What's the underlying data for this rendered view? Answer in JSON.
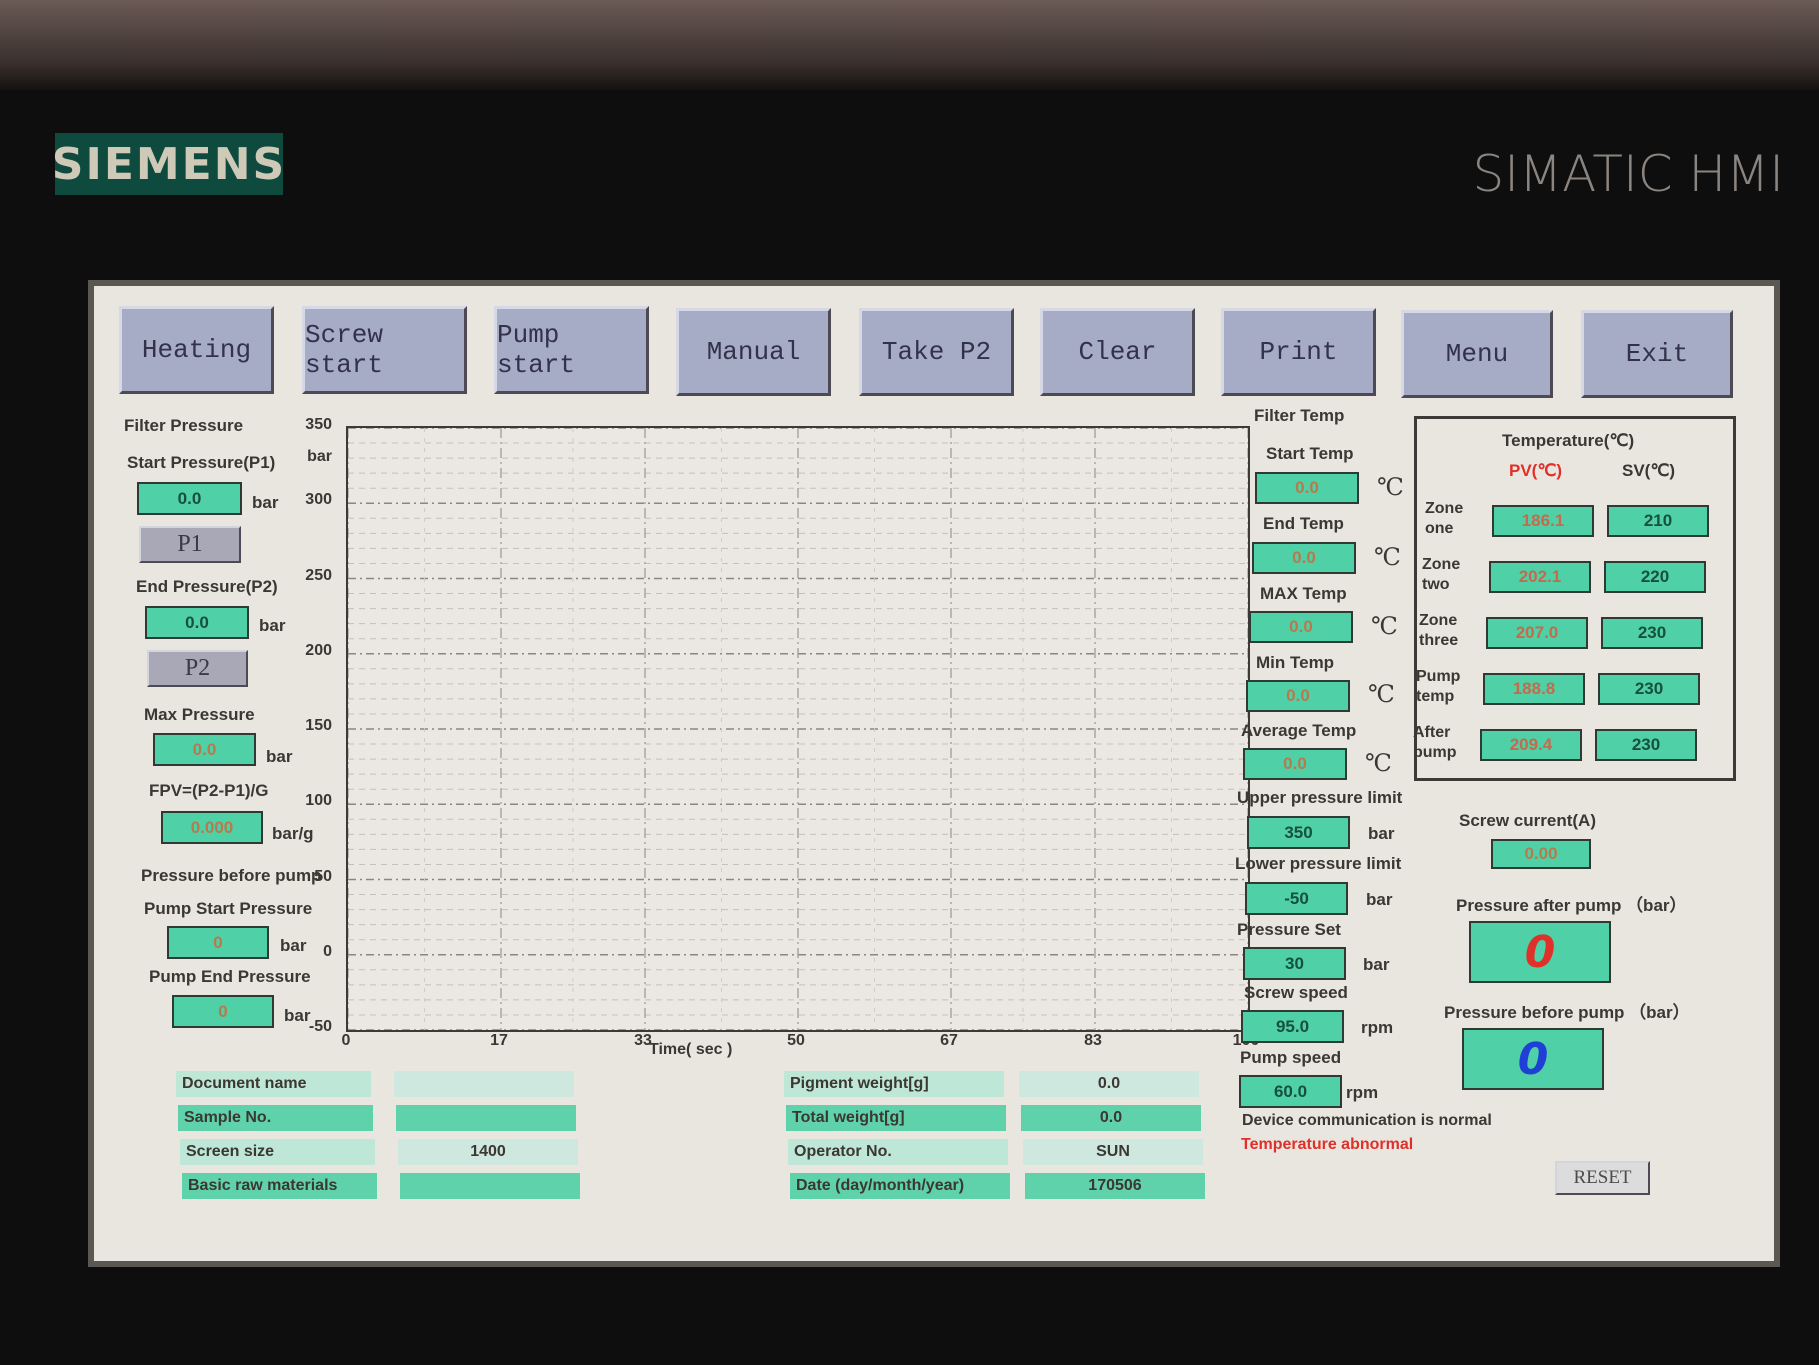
{
  "device": {
    "brand": "SIEMENS",
    "model": "SIMATIC HMI"
  },
  "toolbar": {
    "buttons": [
      "Heating",
      "Screw start",
      "Pump start",
      "Manual",
      "Take P2",
      "Clear",
      "Print",
      "Menu",
      "Exit"
    ]
  },
  "filter_pressure": {
    "title": "Filter Pressure",
    "start_label": "Start Pressure(P1)",
    "start_value": "0.0",
    "p1_button": "P1",
    "end_label": "End Pressure(P2)",
    "end_value": "0.0",
    "p2_button": "P2",
    "max_label": "Max Pressure",
    "max_value": "0.0",
    "fpv_label": "FPV=(P2-P1)/G",
    "fpv_value": "0.000",
    "unit_bar": "bar",
    "unit_barg": "bar/g"
  },
  "pump_pressure": {
    "title": "Pressure before pump",
    "start_label": "Pump Start Pressure",
    "start_value": "0",
    "end_label": "Pump End Pressure",
    "end_value": "0",
    "unit": "bar"
  },
  "chart_data": {
    "type": "line",
    "title": "",
    "xlabel": "Time( sec )",
    "ylabel": "bar",
    "x_ticks": [
      "0",
      "17",
      "33",
      "50",
      "67",
      "83",
      "100"
    ],
    "y_ticks": [
      "350",
      "300",
      "250",
      "200",
      "150",
      "100",
      "50",
      "0",
      "-50"
    ],
    "xlim": [
      0,
      100
    ],
    "ylim": [
      -50,
      350
    ],
    "grid": true,
    "series": []
  },
  "filter_temp": {
    "title": "Filter Temp",
    "unit": "℃",
    "items": [
      {
        "label": "Start Temp",
        "value": "0.0"
      },
      {
        "label": "End Temp",
        "value": "0.0"
      },
      {
        "label": "MAX Temp",
        "value": "0.0"
      },
      {
        "label": "Min Temp",
        "value": "0.0"
      },
      {
        "label": "Average Temp",
        "value": "0.0"
      }
    ]
  },
  "limits": {
    "upper_label": "Upper pressure limit",
    "upper_value": "350",
    "lower_label": "Lower pressure limit",
    "lower_value": "-50",
    "set_label": "Pressure Set",
    "set_value": "30",
    "screw_label": "Screw speed",
    "screw_value": "95.0",
    "pump_label": "Pump speed",
    "pump_value": "60.0",
    "unit_bar": "bar",
    "unit_rpm": "rpm"
  },
  "temperature": {
    "title": "Temperature(℃)",
    "pv_header": "PV(℃)",
    "sv_header": "SV(℃)",
    "zones": [
      {
        "label1": "Zone",
        "label2": "one",
        "pv": "186.1",
        "sv": "210"
      },
      {
        "label1": "Zone",
        "label2": "two",
        "pv": "202.1",
        "sv": "220"
      },
      {
        "label1": "Zone",
        "label2": "three",
        "pv": "207.0",
        "sv": "230"
      },
      {
        "label1": "Pump",
        "label2": "temp",
        "pv": "188.8",
        "sv": "230"
      },
      {
        "label1": "After",
        "label2": "pump",
        "pv": "209.4",
        "sv": "230"
      }
    ]
  },
  "screw_current": {
    "label": "Screw current(A)",
    "value": "0.00"
  },
  "pressure_after_pump": {
    "label": "Pressure after pump （bar）",
    "value": "0",
    "color": "#e0302a"
  },
  "pressure_before_pump": {
    "label": "Pressure before pump （bar）",
    "value": "0",
    "color": "#1f3fd6"
  },
  "status": {
    "comm": "Device communication is normal",
    "temp": "Temperature abnormal",
    "temp_color": "#e0302a"
  },
  "reset_button": "RESET",
  "info_table": {
    "left": [
      {
        "label": "Document name",
        "value": ""
      },
      {
        "label": "Sample No.",
        "value": ""
      },
      {
        "label": "Screen size",
        "value": "1400"
      },
      {
        "label": "Basic raw materials",
        "value": ""
      }
    ],
    "right": [
      {
        "label": "Pigment weight[g]",
        "value": "0.0"
      },
      {
        "label": "Total weight[g]",
        "value": "0.0"
      },
      {
        "label": "Operator No.",
        "value": "SUN"
      },
      {
        "label": "Date (day/month/year)",
        "value": "170506"
      }
    ]
  }
}
